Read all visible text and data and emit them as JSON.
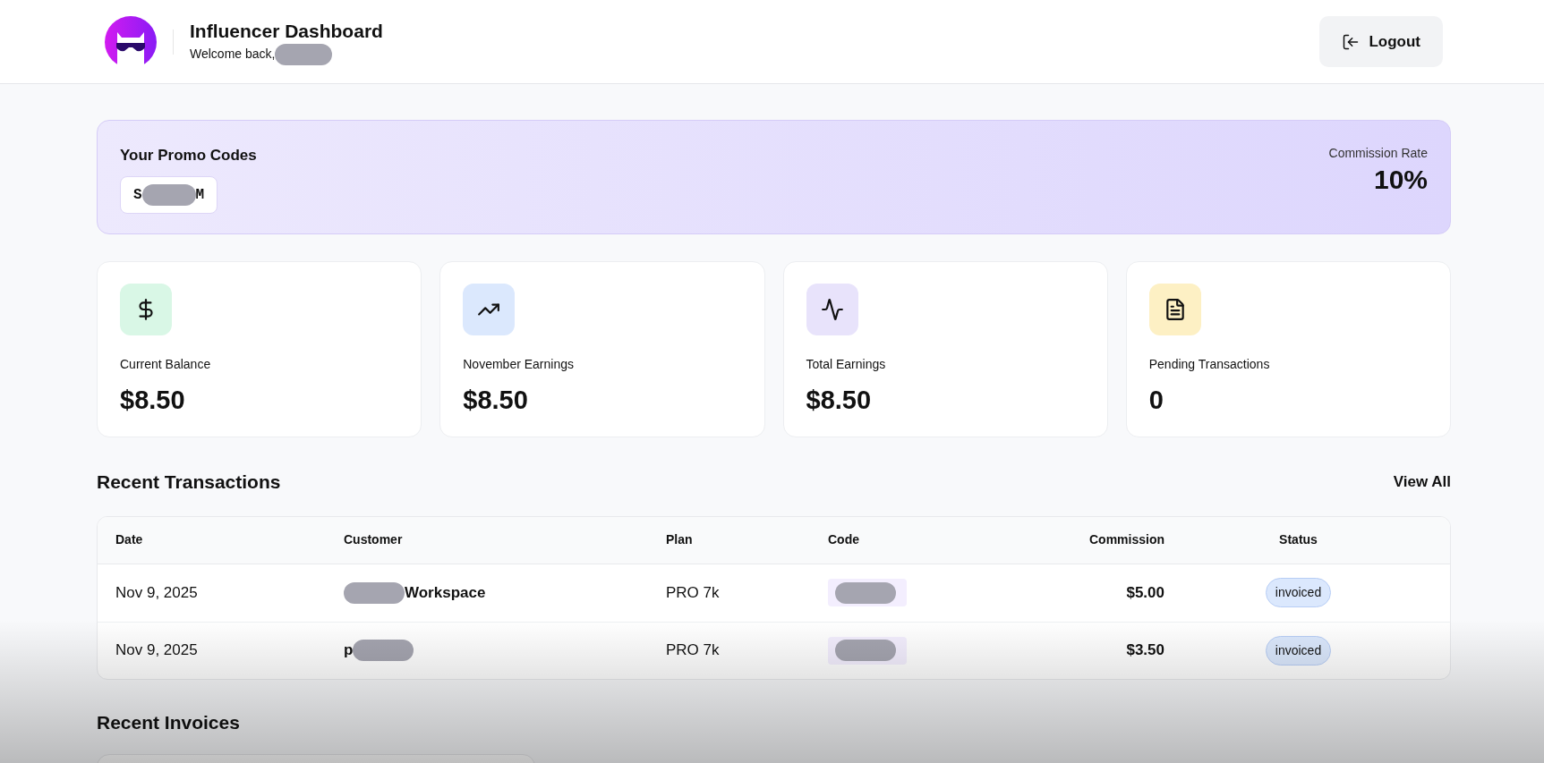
{
  "header": {
    "title": "Influencer Dashboard",
    "welcome": "Welcome back,",
    "logout": "Logout"
  },
  "promo": {
    "title": "Your Promo Codes",
    "codes": [
      {
        "prefix": "S",
        "suffix": "M"
      }
    ],
    "rate_label": "Commission Rate",
    "rate": "10%"
  },
  "stats": [
    {
      "kind": "dollar",
      "label": "Current Balance",
      "value": "$8.50"
    },
    {
      "kind": "trend",
      "label": "November Earnings",
      "value": "$8.50"
    },
    {
      "kind": "activity",
      "label": "Total Earnings",
      "value": "$8.50"
    },
    {
      "kind": "document",
      "label": "Pending Transactions",
      "value": "0"
    }
  ],
  "transactions": {
    "title": "Recent Transactions",
    "view_all": "View All",
    "columns": [
      "Date",
      "Customer",
      "Plan",
      "Code",
      "Commission",
      "Status"
    ],
    "rows": [
      {
        "date": "Nov 9, 2025",
        "customer_prefix": "",
        "customer_suffix": "Workspace",
        "plan": "PRO 7k",
        "commission": "$5.00",
        "status": "invoiced"
      },
      {
        "date": "Nov 9, 2025",
        "customer_prefix": "p",
        "customer_suffix": "",
        "plan": "PRO 7k",
        "commission": "$3.50",
        "status": "invoiced"
      }
    ]
  },
  "invoices": {
    "title": "Recent Invoices"
  }
}
